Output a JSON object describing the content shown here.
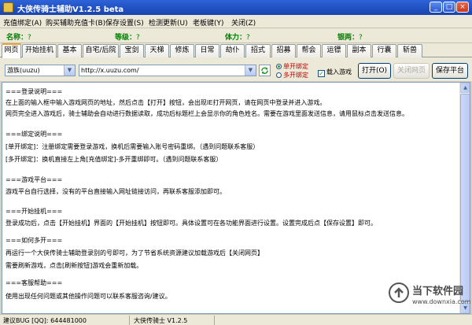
{
  "window": {
    "title": "大侠传骑士辅助V1.2.5 beta",
    "min": "_",
    "max": "□",
    "close": "×"
  },
  "menu": [
    "充值绑定(A)",
    "购买辅助充值卡(B)",
    "保存设置(S)",
    "检测更新(U)",
    "老板键(Y)",
    "关闭(Z)"
  ],
  "info": [
    {
      "label": "名称：",
      "value": "?"
    },
    {
      "label": "等级：",
      "value": "?"
    },
    {
      "label": "体力：",
      "value": "?"
    },
    {
      "label": "银两：",
      "value": "?"
    }
  ],
  "tabs": [
    "网页",
    "开始挂机",
    "基本",
    "自宅/后院",
    "宝剑",
    "天梯",
    "修炼",
    "日常",
    "劫仆",
    "招式",
    "招募",
    "帮会",
    "运镖",
    "副本",
    "行囊",
    "斩兽"
  ],
  "active_tab": "网页",
  "toolbar": {
    "platform_select": "游族(uuzu)",
    "url_value": "http://x.uuzu.com/",
    "radio_single": "单开绑定",
    "radio_multi": "多开绑定",
    "checkbox_load": "载入游戏",
    "checkbox_checked": true,
    "open_button": "打开(O)",
    "close_page_button": "关闭网页",
    "save_platform_button": "保存平台"
  },
  "content_lines": [
    "===登录说明===",
    "在上面的输入框中输入游戏网页的地址，然后点击【打开】按钮，会出现IE打开网页，请在网页中登录并进入游戏。",
    "网页完全进入游戏后，骑士辅助会自动进行数据读取，成功后标题栏上会显示你的角色姓名。需要在游戏里面发送信息，请用鼠标点击发送信息。",
    "===绑定说明===",
    "[单开绑定]：注册绑定需要登录游戏，换机后需要输入账号密码重绑。（遇到问题联系客服）",
    "[多开绑定]：换机直接左上角[充值绑定]-多开重绑即可。（遇到问题联系客服）",
    "===游戏平台===",
    "游戏平台自行选择，没有的平台直接输入网址链接访问，再联系客服添加即可。",
    "===开始挂机===",
    "登录成功后，点击【开始挂机】界面的【开始挂机】按钮即可。具体设置可在各功能界面进行设置。设置完成后点【保存设置】即可。",
    "===如何多开===",
    "再运行一个大侠传骑士辅助登录别的号即可，为了节省系统资源建议加载游戏后【关闭网页】",
    "需要刷新游戏，点击[刷新按钮]游戏会重新加载。",
    "===客服帮助===",
    "使用出现任何问题或其他操作问题可以联系客服咨询/建议。"
  ],
  "status": {
    "left": "建议BUG [QQ]: 644481000",
    "right": "大侠传骑士 V1.2.5"
  },
  "watermark": {
    "name": "当下软件园",
    "url": "www.downxia.com"
  },
  "colors": {
    "titlebar": "#2156c9",
    "info_text": "#008000",
    "radio_text": "#c00000",
    "active_tab_accent": "#f0a030"
  }
}
